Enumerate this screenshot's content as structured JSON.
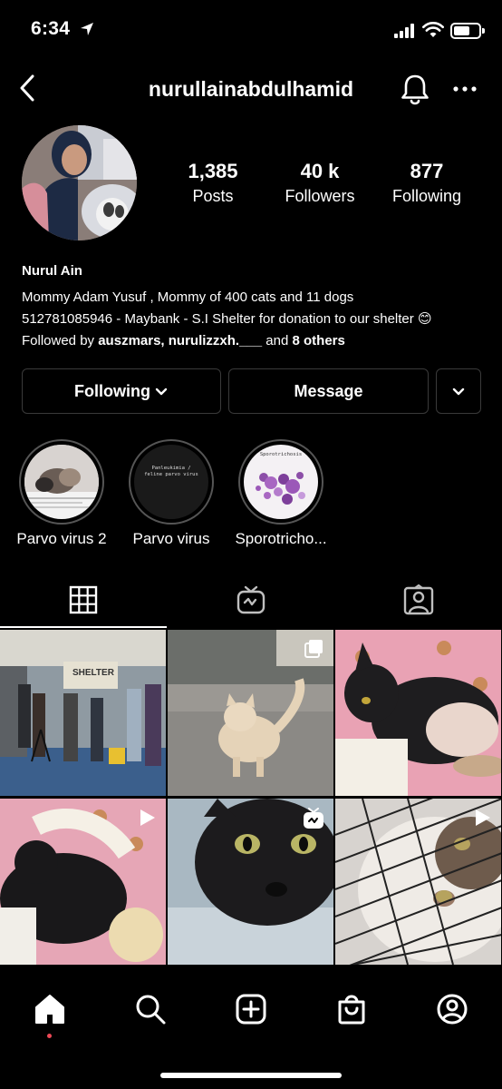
{
  "status_bar": {
    "time": "6:34"
  },
  "header": {
    "username": "nurullainabdulhamid"
  },
  "profile": {
    "stats": [
      {
        "value": "1,385",
        "label": "Posts"
      },
      {
        "value": "40 k",
        "label": "Followers"
      },
      {
        "value": "877",
        "label": "Following"
      }
    ],
    "name": "Nurul Ain",
    "bio_line1": "Mommy Adam Yusuf , Mommy of 400 cats and 11 dogs",
    "bio_line2": "512781085946 - Maybank - S.I Shelter for donation to our shelter 😊",
    "followed_by_prefix": "Followed by ",
    "followed_by_users": "auszmars, nurulizzxh.___",
    "followed_by_and": " and ",
    "followed_by_others": "8 others"
  },
  "buttons": {
    "following": "Following",
    "message": "Message"
  },
  "highlights": [
    {
      "label": "Parvo virus 2"
    },
    {
      "label": "Parvo virus",
      "cover_text": "Panleukimia / feline parvo virus"
    },
    {
      "label": "Sporotricho...",
      "cover_text": "Sporotrichosis"
    }
  ],
  "posts": [
    {
      "kind": "carousel",
      "sign_text": "SHELTER"
    },
    {
      "kind": "carousel"
    },
    {
      "kind": "photo"
    },
    {
      "kind": "video"
    },
    {
      "kind": "igtv"
    },
    {
      "kind": "video"
    }
  ],
  "colors": {
    "notification_dot": "#ed4956",
    "background": "#000000",
    "border": "#3a3a3a"
  }
}
